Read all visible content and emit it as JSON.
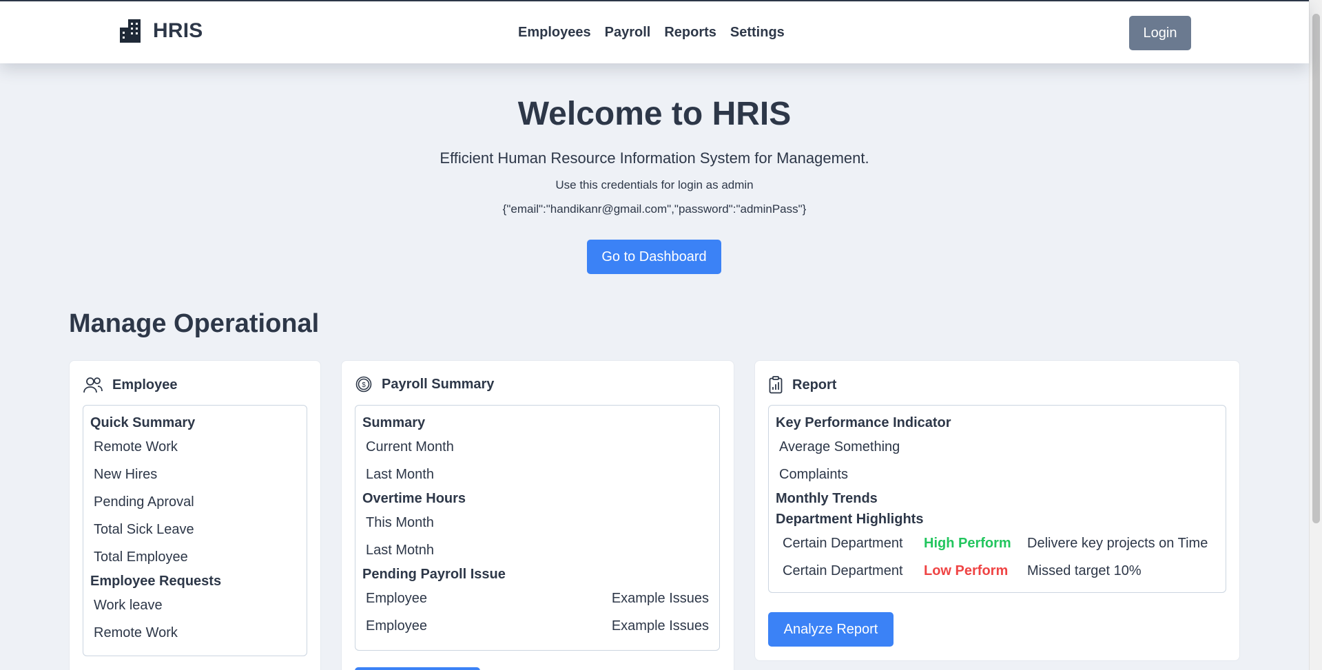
{
  "header": {
    "brand": "HRIS",
    "nav": [
      "Employees",
      "Payroll",
      "Reports",
      "Settings"
    ],
    "login_label": "Login"
  },
  "hero": {
    "title": "Welcome to HRIS",
    "subtitle": "Efficient Human Resource Information System for Management.",
    "note": "Use this credentials for login as admin",
    "credentials": "{\"email\":\"handikanr@gmail.com\",\"password\":\"adminPass\"}",
    "dashboard_button": "Go to Dashboard"
  },
  "section_title": "Manage Operational",
  "employee_card": {
    "title": "Employee",
    "quick_summary_heading": "Quick Summary",
    "quick_summary": [
      "Remote Work",
      "New Hires",
      "Pending Aproval",
      "Total Sick Leave",
      "Total Employee"
    ],
    "requests_heading": "Employee Requests",
    "requests": [
      "Work leave",
      "Remote Work"
    ]
  },
  "payroll_card": {
    "title": "Payroll Summary",
    "summary_heading": "Summary",
    "summary": [
      "Current Month",
      "Last Month"
    ],
    "overtime_heading": "Overtime Hours",
    "overtime": [
      "This Month",
      "Last Motnh"
    ],
    "pending_heading": "Pending Payroll Issue",
    "pending": [
      {
        "employee": "Employee",
        "issue": "Example Issues"
      },
      {
        "employee": "Employee",
        "issue": "Example Issues"
      }
    ]
  },
  "report_card": {
    "title": "Report",
    "kpi_heading": "Key Performance Indicator",
    "kpi": [
      "Average Something",
      "Complaints"
    ],
    "trends_heading": "Monthly Trends",
    "highlights_heading": "Department Highlights",
    "highlights": [
      {
        "department": "Certain Department",
        "status": "High Perform",
        "note": "Delivere key projects on Time",
        "status_color": "#22c55e"
      },
      {
        "department": "Certain Department",
        "status": "Low Perform",
        "note": "Missed target 10%",
        "status_color": "#ef4444"
      }
    ],
    "analyze_button": "Analyze Report"
  },
  "colors": {
    "primary": "#3b82f6",
    "login_button": "#6b7a90",
    "background": "#eef1f6",
    "text": "#2d3748"
  },
  "icons": {
    "brand": "building-icon",
    "employee": "users-icon",
    "payroll": "dollar-coin-icon",
    "report": "clipboard-chart-icon"
  }
}
